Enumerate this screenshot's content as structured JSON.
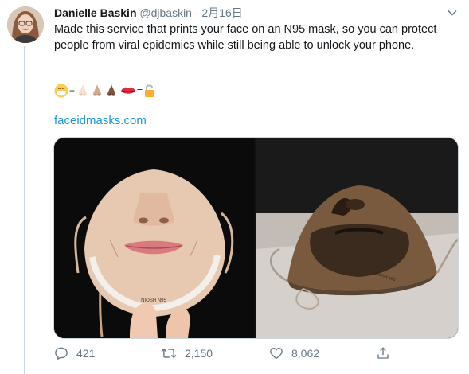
{
  "tweet": {
    "author_name": "Danielle Baskin",
    "handle": "@djbaskin",
    "separator": "·",
    "date": "2月16日",
    "text": "Made this service that prints your face on an N95 mask, so you can protect people from viral epidemics while still being able to unlock your phone.",
    "emoji_sequence": {
      "icons": [
        "mask-face-emoji",
        "nose-light-emoji",
        "nose-medium-emoji",
        "nose-dark-emoji",
        "lips-emoji",
        "unlocked-padlock-emoji"
      ],
      "plus": "+",
      "equals": "="
    },
    "link": "faceidmasks.com"
  },
  "actions": {
    "reply_count": "421",
    "retweet_count": "2,150",
    "like_count": "8,062"
  },
  "colors": {
    "link": "#1b95e0",
    "muted": "#657786",
    "thread_line": "#ccd6dd"
  }
}
